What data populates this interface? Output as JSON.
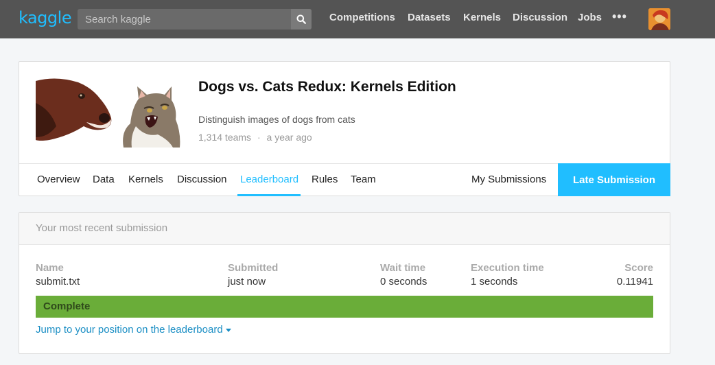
{
  "brand": {
    "logo": "kaggle",
    "accent": "#20beff"
  },
  "search": {
    "placeholder": "Search kaggle",
    "icon": "search-icon"
  },
  "nav": {
    "items": [
      "Competitions",
      "Datasets",
      "Kernels",
      "Discussion",
      "Jobs"
    ],
    "more": "•••"
  },
  "competition": {
    "title": "Dogs vs. Cats Redux: Kernels Edition",
    "subtitle": "Distinguish images of dogs from cats",
    "teams": "1,314 teams",
    "separator": "·",
    "age": "a year ago"
  },
  "tabs": {
    "items": [
      "Overview",
      "Data",
      "Kernels",
      "Discussion",
      "Leaderboard",
      "Rules",
      "Team"
    ],
    "active": "Leaderboard",
    "my_submissions": "My Submissions",
    "late_submission": "Late Submission"
  },
  "submission": {
    "panel_title": "Your most recent submission",
    "columns": {
      "name": "Name",
      "submitted": "Submitted",
      "wait": "Wait time",
      "execution": "Execution time",
      "score": "Score"
    },
    "values": {
      "name": "submit.txt",
      "submitted": "just now",
      "wait": "0 seconds",
      "execution": "1 seconds",
      "score": "0.11941"
    },
    "status": "Complete",
    "status_color": "#6aad39",
    "jump_link": "Jump to your position on the leaderboard"
  }
}
